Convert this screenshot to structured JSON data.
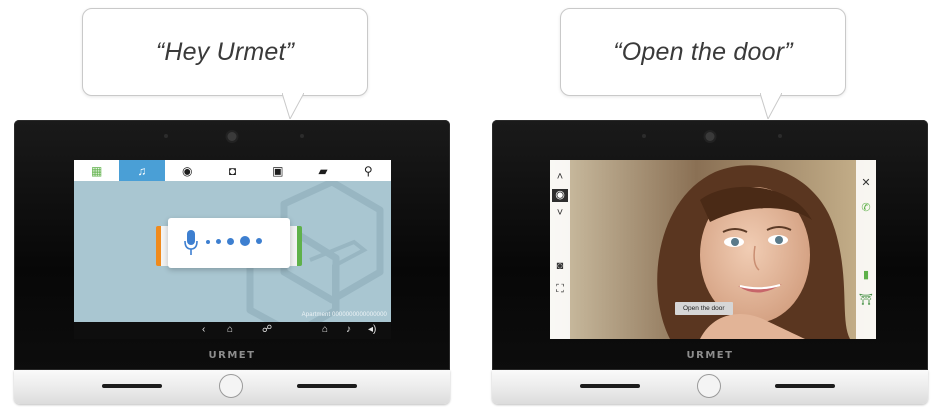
{
  "left": {
    "bubble_text": "“Hey Urmet”",
    "brand": "URMET",
    "tabs": [
      {
        "icon": "grid-icon",
        "glyph": "▦"
      },
      {
        "icon": "intercom-icon",
        "glyph": "♫"
      },
      {
        "icon": "eye-icon",
        "glyph": "◉"
      },
      {
        "icon": "answering-machine-icon",
        "glyph": "◘"
      },
      {
        "icon": "memo-icon",
        "glyph": "▣"
      },
      {
        "icon": "messages-icon",
        "glyph": "▰"
      },
      {
        "icon": "key-icon",
        "glyph": "⚲"
      }
    ],
    "bottom_icons": [
      {
        "icon": "back-icon",
        "glyph": "‹"
      },
      {
        "icon": "home-icon",
        "glyph": "⌂"
      },
      {
        "icon": "call-forward-icon",
        "glyph": "☍"
      },
      {
        "icon": "house-icon",
        "glyph": "⌂"
      },
      {
        "icon": "bell-icon",
        "glyph": "♪"
      },
      {
        "icon": "volume-icon",
        "glyph": "◂)"
      }
    ],
    "apartment_label": "Apartment 0000000000000000"
  },
  "right": {
    "bubble_text": "“Open the door”",
    "brand": "URMET",
    "caption": "Open the door",
    "left_panel": [
      {
        "icon": "chevron-up-icon",
        "glyph": "˄"
      },
      {
        "icon": "eye-icon",
        "glyph": "◉"
      },
      {
        "icon": "chevron-down-icon",
        "glyph": "˅"
      },
      {
        "icon": "camera-icon",
        "glyph": "◙"
      },
      {
        "icon": "fullscreen-icon",
        "glyph": "⛶"
      }
    ],
    "right_panel": [
      {
        "icon": "close-icon",
        "glyph": "✕"
      },
      {
        "icon": "phone-icon",
        "glyph": "✆"
      },
      {
        "icon": "door-icon",
        "glyph": "▮"
      },
      {
        "icon": "gate-icon",
        "glyph": "⛩"
      }
    ]
  },
  "colors": {
    "tab_active": "#4a9fd6",
    "door_accent_green": "#5fb14a",
    "door_accent_orange": "#f08a1c",
    "voice_blue": "#3d7fd0"
  }
}
